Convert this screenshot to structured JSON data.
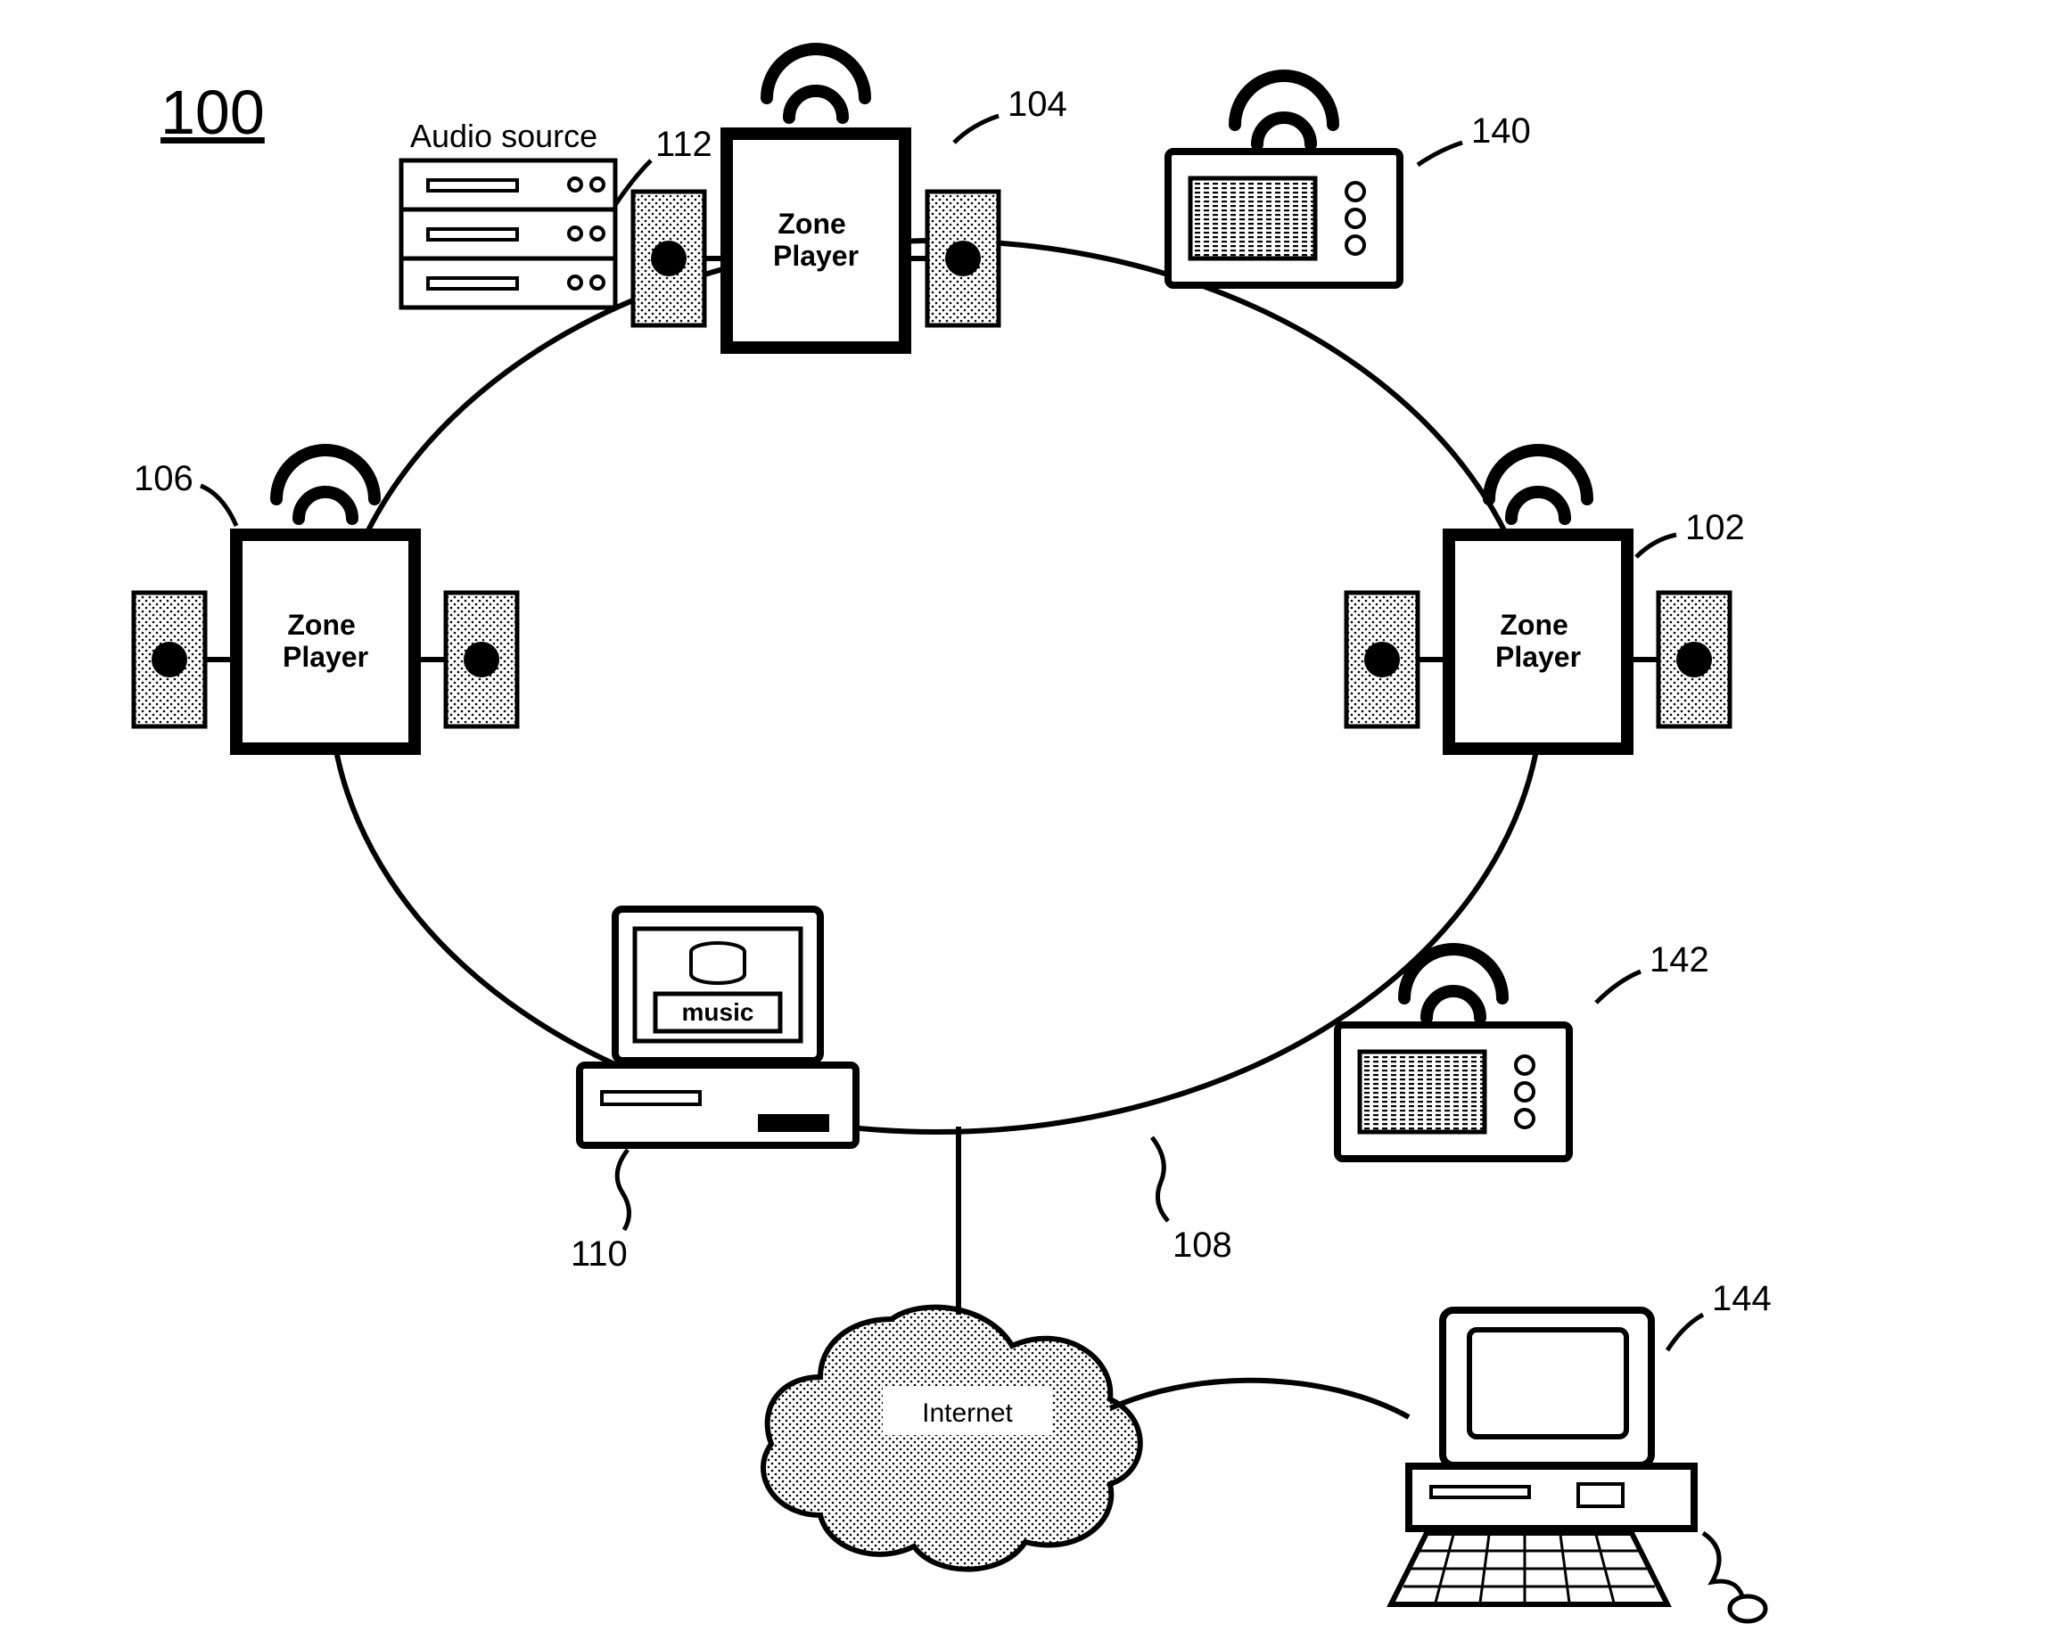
{
  "figure_number": "100",
  "labels": {
    "audio_source": "Audio source",
    "zone_player": "Zone\nPlayer",
    "music": "music",
    "internet": "Internet"
  },
  "refs": {
    "r100": "100",
    "r102": "102",
    "r104": "104",
    "r106": "106",
    "r108": "108",
    "r110": "110",
    "r112": "112",
    "r140": "140",
    "r142": "142",
    "r144": "144"
  }
}
